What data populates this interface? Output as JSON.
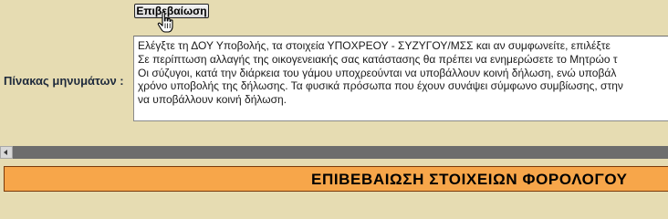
{
  "toolbar": {
    "confirm_label": "Επιβεβαίωση"
  },
  "messages": {
    "label": "Πίνακας μηνυμάτων :",
    "lines": [
      "Ελέγξτε τη ΔΟΥ Υποβολής, τα στοιχεία ΥΠΟΧΡΕΟΥ - ΣΥΖΥΓΟΥ/ΜΣΣ και αν συμφωνείτε, επιλέξτε",
      "Σε περίπτωση αλλαγής της οικογενειακής σας κατάστασης θα πρέπει να ενημερώσετε το Μητρώο τ",
      "Οι σύζυγοι, κατά την διάρκεια του γάμου υποχρεούνται να υποβάλλουν κοινή δήλωση, ενώ υποβάλ",
      "χρόνο υποβολής της δήλωσης. Τα φυσικά πρόσωπα που έχουν συνάψει σύμφωνο συμβίωσης, στην",
      "να υποβάλλουν κοινή δήλωση."
    ]
  },
  "section": {
    "title": "ΕΠΙΒΕΒΑΙΩΣΗ ΣΤΟΙΧΕΙΩΝ ΦΟΡΟΛΟΓΟΥ"
  },
  "icons": {
    "cursor": "hand-pointer-icon",
    "scroll_left": "arrow-left-icon"
  },
  "colors": {
    "page_bg": "#e6dcb2",
    "header_bg": "#f7a64a",
    "header_border": "#7a3a0a"
  }
}
